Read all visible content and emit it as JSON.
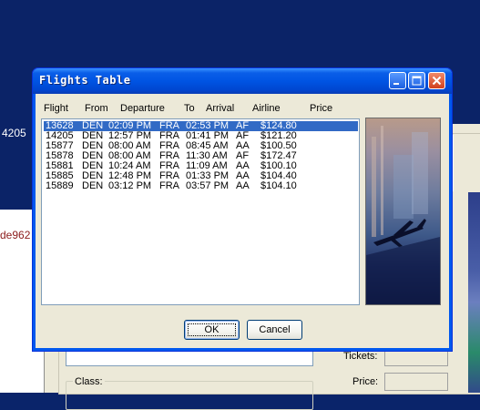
{
  "background": {
    "left_text_number": "4205",
    "left_text_link": "de962",
    "tickets_label": "Tickets:",
    "price_label": "Price:",
    "class_label": "Class:"
  },
  "dialog": {
    "title": "Flights Table",
    "headers": [
      "Flight",
      "From",
      "Departure",
      "To",
      "Arrival",
      "Airline",
      "Price"
    ],
    "rows": [
      {
        "flight": "13628",
        "from": "DEN",
        "departure": "02:09 PM",
        "to": "FRA",
        "arrival": "02:53 PM",
        "airline": "AF",
        "price": "$124.80",
        "selected": true
      },
      {
        "flight": "14205",
        "from": "DEN",
        "departure": "12:57 PM",
        "to": "FRA",
        "arrival": "01:41 PM",
        "airline": "AF",
        "price": "$121.20",
        "selected": false
      },
      {
        "flight": "15877",
        "from": "DEN",
        "departure": "08:00 AM",
        "to": "FRA",
        "arrival": "08:45 AM",
        "airline": "AA",
        "price": "$100.50",
        "selected": false
      },
      {
        "flight": "15878",
        "from": "DEN",
        "departure": "08:00 AM",
        "to": "FRA",
        "arrival": "11:30 AM",
        "airline": "AF",
        "price": "$172.47",
        "selected": false
      },
      {
        "flight": "15881",
        "from": "DEN",
        "departure": "10:24 AM",
        "to": "FRA",
        "arrival": "11:09 AM",
        "airline": "AA",
        "price": "$100.10",
        "selected": false
      },
      {
        "flight": "15885",
        "from": "DEN",
        "departure": "12:48 PM",
        "to": "FRA",
        "arrival": "01:33 PM",
        "airline": "AA",
        "price": "$104.40",
        "selected": false
      },
      {
        "flight": "15889",
        "from": "DEN",
        "departure": "03:12 PM",
        "to": "FRA",
        "arrival": "03:57 PM",
        "airline": "AA",
        "price": "$104.10",
        "selected": false
      }
    ],
    "ok_label": "OK",
    "cancel_label": "Cancel"
  },
  "icons": {
    "minimize": "minimize-icon",
    "maximize": "maximize-icon",
    "close": "close-icon",
    "airplane_photo": "airplane-photo"
  },
  "colors": {
    "titlebar": "#0054e3",
    "selection": "#316ac5",
    "desktop": "#0b2367",
    "dialog_face": "#ece9d8"
  }
}
